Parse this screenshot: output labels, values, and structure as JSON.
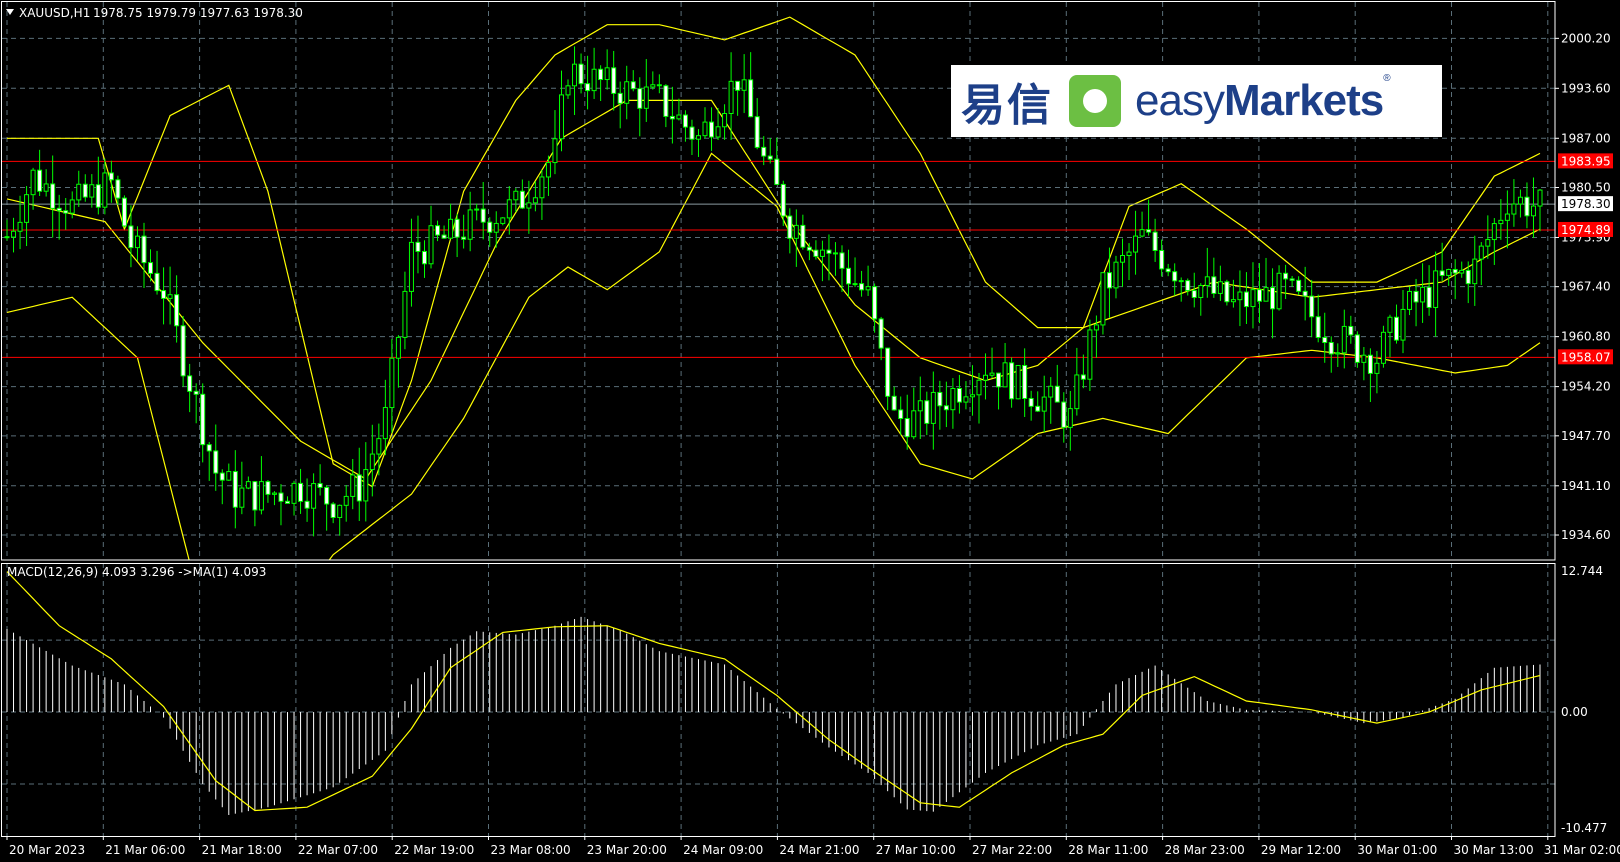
{
  "header": {
    "symbol": "XAUUSD,H1",
    "ohlc": "1978.75 1979.79 1977.63 1978.30"
  },
  "macd": {
    "label": "MACD(12,26,9) 4.093 3.296  ->MA(1) 4.093",
    "ticks": [
      "12.744",
      "0.00",
      "-10.477"
    ]
  },
  "logo": {
    "cn": "易信",
    "en_light": "easy",
    "en_bold": "Markets",
    "reg": "®"
  },
  "colors": {
    "background": "#000000",
    "bullish": "#00ff00",
    "bearish_body": "#ffffff",
    "band": "#ffff00",
    "level": "#ff0000",
    "grid": "#5a6e78",
    "histogram": "#ffffff",
    "signal": "#ffff00"
  },
  "chart_data": {
    "type": "candlestick",
    "y_ticks": [
      2000.2,
      1993.6,
      1987.0,
      1980.5,
      1973.9,
      1967.4,
      1960.8,
      1954.2,
      1947.7,
      1941.1,
      1934.6
    ],
    "ylim": [
      1931.3,
      2005.0
    ],
    "x_ticks": [
      "20 Mar 2023",
      "21 Mar 06:00",
      "21 Mar 18:00",
      "22 Mar 07:00",
      "22 Mar 19:00",
      "23 Mar 08:00",
      "23 Mar 20:00",
      "24 Mar 09:00",
      "24 Mar 21:00",
      "27 Mar 10:00",
      "27 Mar 22:00",
      "28 Mar 11:00",
      "28 Mar 23:00",
      "29 Mar 12:00",
      "30 Mar 01:00",
      "30 Mar 13:00",
      "31 Mar 02:00"
    ],
    "bar_count": 236,
    "levels": [
      {
        "label": "1983.95",
        "value": 1983.95
      },
      {
        "label": "1974.89",
        "value": 1974.89
      },
      {
        "label": "1958.07",
        "value": 1958.07
      }
    ],
    "current_price": {
      "label": "1978.30",
      "value": 1978.3
    },
    "close_path": [
      [
        0,
        1974
      ],
      [
        4,
        1982
      ],
      [
        10,
        1978
      ],
      [
        16,
        1981
      ],
      [
        19,
        1973
      ],
      [
        24,
        1967
      ],
      [
        28,
        1955
      ],
      [
        32,
        1943
      ],
      [
        35,
        1940
      ],
      [
        40,
        1940
      ],
      [
        45,
        1941
      ],
      [
        50,
        1939
      ],
      [
        54,
        1941
      ],
      [
        58,
        1950
      ],
      [
        62,
        1972
      ],
      [
        68,
        1974
      ],
      [
        72,
        1976
      ],
      [
        78,
        1978
      ],
      [
        84,
        1985
      ],
      [
        86,
        1996
      ],
      [
        92,
        1994
      ],
      [
        100,
        1992
      ],
      [
        106,
        1987
      ],
      [
        112,
        1995
      ],
      [
        116,
        1984
      ],
      [
        120,
        1976
      ],
      [
        126,
        1972
      ],
      [
        132,
        1966
      ],
      [
        136,
        1950
      ],
      [
        140,
        1950
      ],
      [
        150,
        1957
      ],
      [
        160,
        1952
      ],
      [
        163,
        1950
      ],
      [
        168,
        1967
      ],
      [
        174,
        1974
      ],
      [
        180,
        1969
      ],
      [
        188,
        1965
      ],
      [
        196,
        1967
      ],
      [
        203,
        1961
      ],
      [
        210,
        1958
      ],
      [
        214,
        1964
      ],
      [
        220,
        1968
      ],
      [
        225,
        1970
      ],
      [
        230,
        1979
      ],
      [
        235,
        1978
      ]
    ],
    "bollinger": {
      "upper": [
        [
          0,
          1987
        ],
        [
          14,
          1987
        ],
        [
          18,
          1975
        ],
        [
          25,
          1990
        ],
        [
          34,
          1994
        ],
        [
          40,
          1980
        ],
        [
          50,
          1944
        ],
        [
          56,
          1941
        ],
        [
          62,
          1955
        ],
        [
          70,
          1980
        ],
        [
          78,
          1992
        ],
        [
          84,
          1998
        ],
        [
          92,
          2002
        ],
        [
          100,
          2002
        ],
        [
          110,
          2000
        ],
        [
          120,
          2003
        ],
        [
          130,
          1998
        ],
        [
          140,
          1985
        ],
        [
          150,
          1968
        ],
        [
          158,
          1962
        ],
        [
          165,
          1962
        ],
        [
          172,
          1978
        ],
        [
          180,
          1981
        ],
        [
          190,
          1975
        ],
        [
          200,
          1968
        ],
        [
          210,
          1968
        ],
        [
          220,
          1972
        ],
        [
          228,
          1982
        ],
        [
          235,
          1985
        ]
      ],
      "middle": [
        [
          0,
          1979
        ],
        [
          15,
          1976
        ],
        [
          30,
          1960
        ],
        [
          45,
          1947
        ],
        [
          55,
          1942
        ],
        [
          65,
          1955
        ],
        [
          75,
          1973
        ],
        [
          85,
          1987
        ],
        [
          95,
          1992
        ],
        [
          108,
          1992
        ],
        [
          120,
          1976
        ],
        [
          130,
          1965
        ],
        [
          140,
          1958
        ],
        [
          150,
          1955
        ],
        [
          158,
          1957
        ],
        [
          165,
          1962
        ],
        [
          175,
          1965
        ],
        [
          185,
          1968
        ],
        [
          200,
          1966
        ],
        [
          210,
          1967
        ],
        [
          220,
          1968
        ],
        [
          228,
          1972
        ],
        [
          235,
          1975
        ]
      ],
      "lower": [
        [
          0,
          1964
        ],
        [
          10,
          1966
        ],
        [
          20,
          1958
        ],
        [
          28,
          1931
        ],
        [
          38,
          1918
        ],
        [
          50,
          1932
        ],
        [
          56,
          1936
        ],
        [
          62,
          1940
        ],
        [
          70,
          1950
        ],
        [
          80,
          1966
        ],
        [
          86,
          1970
        ],
        [
          92,
          1967
        ],
        [
          100,
          1972
        ],
        [
          108,
          1985
        ],
        [
          118,
          1978
        ],
        [
          130,
          1957
        ],
        [
          140,
          1944
        ],
        [
          148,
          1942
        ],
        [
          158,
          1948
        ],
        [
          168,
          1950
        ],
        [
          178,
          1948
        ],
        [
          190,
          1958
        ],
        [
          200,
          1959
        ],
        [
          210,
          1958
        ],
        [
          222,
          1956
        ],
        [
          230,
          1957
        ],
        [
          235,
          1960
        ]
      ]
    },
    "macd": {
      "ylim": [
        -10.477,
        12.744
      ],
      "histogram": [
        [
          0,
          7.5
        ],
        [
          10,
          4.2
        ],
        [
          18,
          2.5
        ],
        [
          24,
          -0.5
        ],
        [
          30,
          -6.5
        ],
        [
          34,
          -9.3
        ],
        [
          40,
          -8.6
        ],
        [
          50,
          -6.8
        ],
        [
          58,
          -3.5
        ],
        [
          62,
          2.5
        ],
        [
          68,
          5.8
        ],
        [
          72,
          7.3
        ],
        [
          78,
          7.0
        ],
        [
          84,
          7.8
        ],
        [
          88,
          8.6
        ],
        [
          94,
          7.4
        ],
        [
          100,
          5.5
        ],
        [
          110,
          4.3
        ],
        [
          118,
          0.3
        ],
        [
          126,
          -3.2
        ],
        [
          132,
          -5.5
        ],
        [
          138,
          -8.8
        ],
        [
          142,
          -9.0
        ],
        [
          150,
          -5.5
        ],
        [
          158,
          -3.0
        ],
        [
          164,
          -2.0
        ],
        [
          170,
          2.5
        ],
        [
          176,
          4.2
        ],
        [
          184,
          1.0
        ],
        [
          190,
          0.2
        ],
        [
          200,
          0.0
        ],
        [
          208,
          -1.0
        ],
        [
          214,
          -0.5
        ],
        [
          222,
          1.2
        ],
        [
          228,
          4.0
        ],
        [
          235,
          4.3
        ]
      ],
      "signal": [
        [
          0,
          12.7
        ],
        [
          8,
          7.8
        ],
        [
          16,
          4.8
        ],
        [
          24,
          0.5
        ],
        [
          32,
          -6.2
        ],
        [
          38,
          -8.9
        ],
        [
          46,
          -8.6
        ],
        [
          56,
          -5.8
        ],
        [
          62,
          -1.5
        ],
        [
          68,
          4.0
        ],
        [
          76,
          7.2
        ],
        [
          84,
          7.7
        ],
        [
          92,
          7.8
        ],
        [
          100,
          6.2
        ],
        [
          110,
          4.8
        ],
        [
          118,
          1.5
        ],
        [
          126,
          -2.5
        ],
        [
          132,
          -5.0
        ],
        [
          140,
          -8.2
        ],
        [
          146,
          -8.6
        ],
        [
          154,
          -5.5
        ],
        [
          162,
          -3.0
        ],
        [
          168,
          -2.0
        ],
        [
          174,
          1.5
        ],
        [
          182,
          3.2
        ],
        [
          190,
          1.0
        ],
        [
          200,
          0.2
        ],
        [
          210,
          -1.0
        ],
        [
          218,
          0.0
        ],
        [
          226,
          2.0
        ],
        [
          235,
          3.3
        ]
      ]
    }
  }
}
